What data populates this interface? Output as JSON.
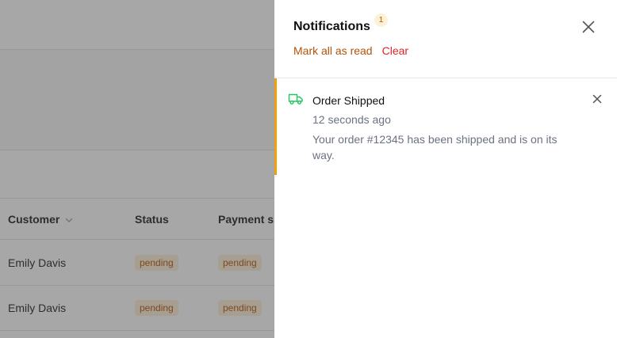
{
  "table": {
    "headers": {
      "customer": "Customer",
      "status": "Status",
      "payment": "Payment s"
    },
    "rows": [
      {
        "customer": "Emily Davis",
        "status": "pending",
        "payment": "pending"
      },
      {
        "customer": "Emily Davis",
        "status": "pending",
        "payment": "pending"
      }
    ]
  },
  "notifications": {
    "title": "Notifications",
    "count": "1",
    "mark_all_label": "Mark all as read",
    "clear_label": "Clear",
    "items": [
      {
        "icon": "truck-icon",
        "title": "Order Shipped",
        "time": "12 seconds ago",
        "body": "Your order #12345 has been shipped and is on its way."
      }
    ]
  },
  "colors": {
    "accent": "#b45309",
    "danger": "#dc2626",
    "notif_border": "#f59e0b",
    "truck_icon": "#22c55e"
  }
}
